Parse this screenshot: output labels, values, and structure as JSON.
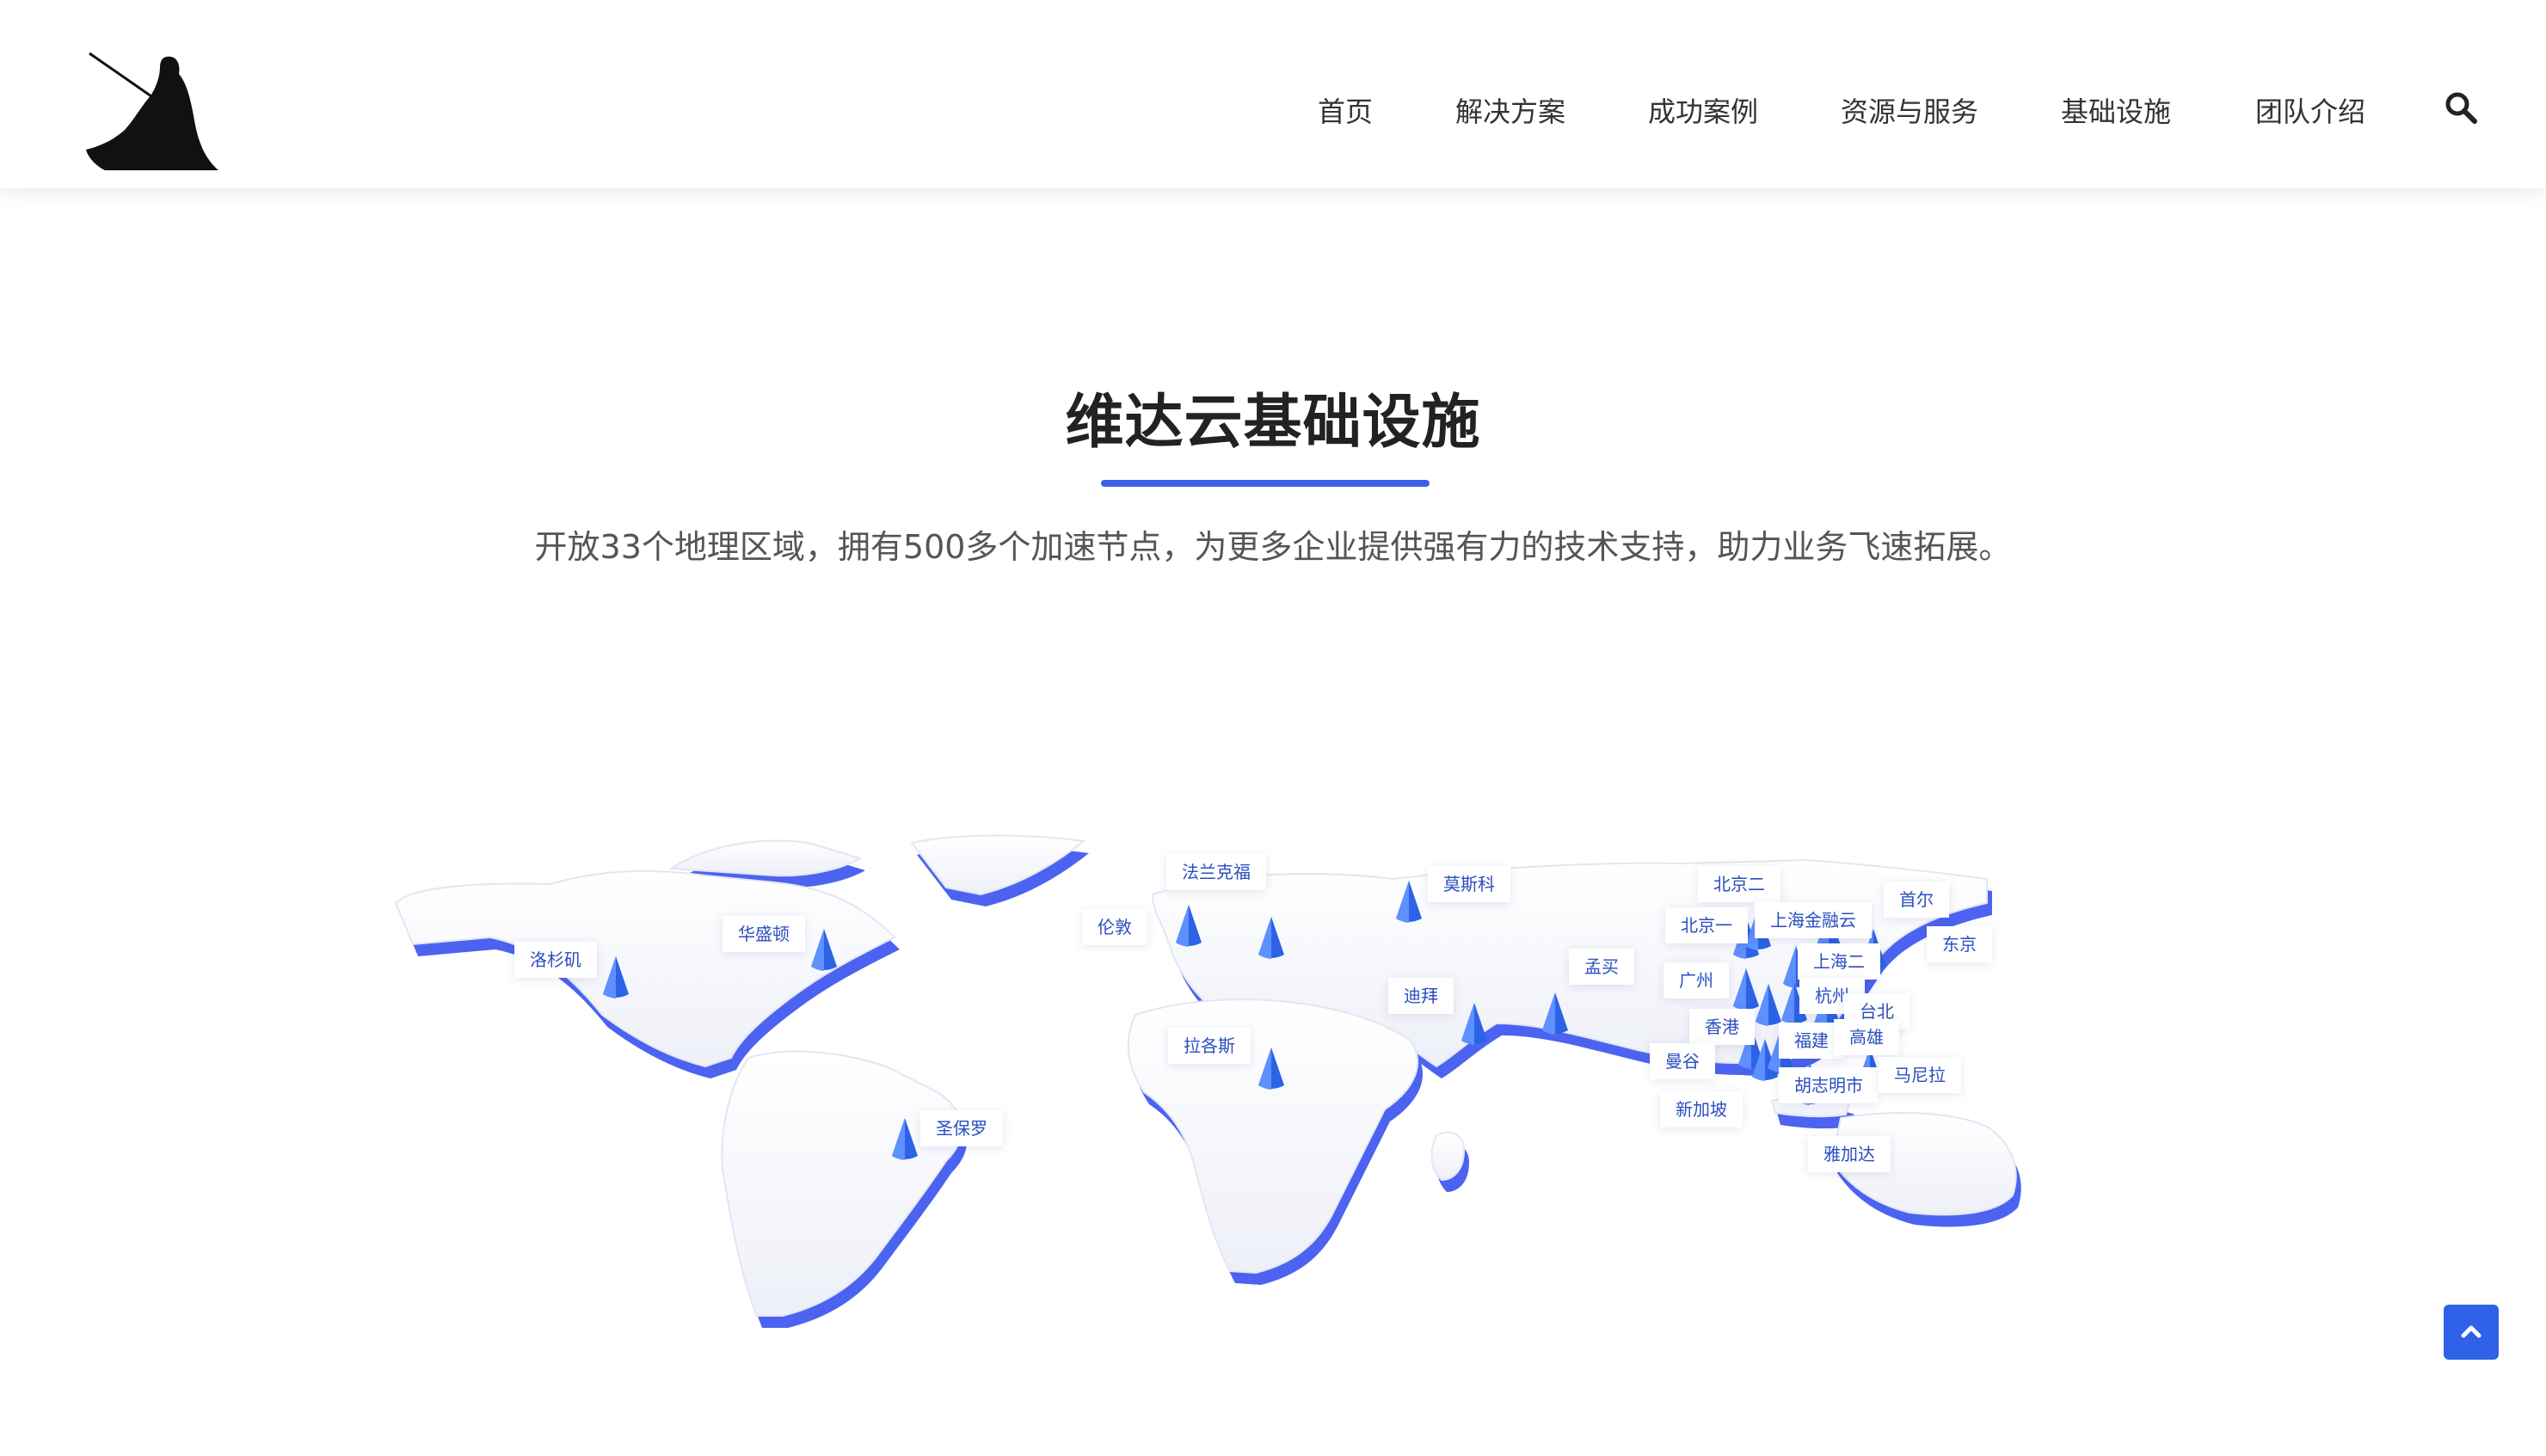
{
  "header": {
    "logo_name": "knight-silhouette-logo",
    "nav": [
      {
        "label": "首页"
      },
      {
        "label": "解决方案"
      },
      {
        "label": "成功案例"
      },
      {
        "label": "资源与服务"
      },
      {
        "label": "基础设施"
      },
      {
        "label": "团队介绍"
      }
    ],
    "search_icon": "search-icon"
  },
  "section": {
    "title": "维达云基础设施",
    "subtitle": "开放33个地理区域，拥有500多个加速节点，为更多企业提供强有力的技术支持，助力业务飞速拓展。"
  },
  "map": {
    "accent_color": "#3d5fe6",
    "cities": [
      {
        "name": "洛杉矶"
      },
      {
        "name": "华盛顿"
      },
      {
        "name": "圣保罗"
      },
      {
        "name": "法兰克福"
      },
      {
        "name": "伦敦"
      },
      {
        "name": "拉各斯"
      },
      {
        "name": "莫斯科"
      },
      {
        "name": "迪拜"
      },
      {
        "name": "孟买"
      },
      {
        "name": "北京二"
      },
      {
        "name": "北京一"
      },
      {
        "name": "上海金融云"
      },
      {
        "name": "首尔"
      },
      {
        "name": "东京"
      },
      {
        "name": "上海二"
      },
      {
        "name": "广州"
      },
      {
        "name": "杭州"
      },
      {
        "name": "台北"
      },
      {
        "name": "香港"
      },
      {
        "name": "福建"
      },
      {
        "name": "高雄"
      },
      {
        "name": "曼谷"
      },
      {
        "name": "胡志明市"
      },
      {
        "name": "马尼拉"
      },
      {
        "name": "新加坡"
      },
      {
        "name": "雅加达"
      }
    ]
  },
  "back_to_top": {
    "icon": "chevron-up-icon"
  }
}
